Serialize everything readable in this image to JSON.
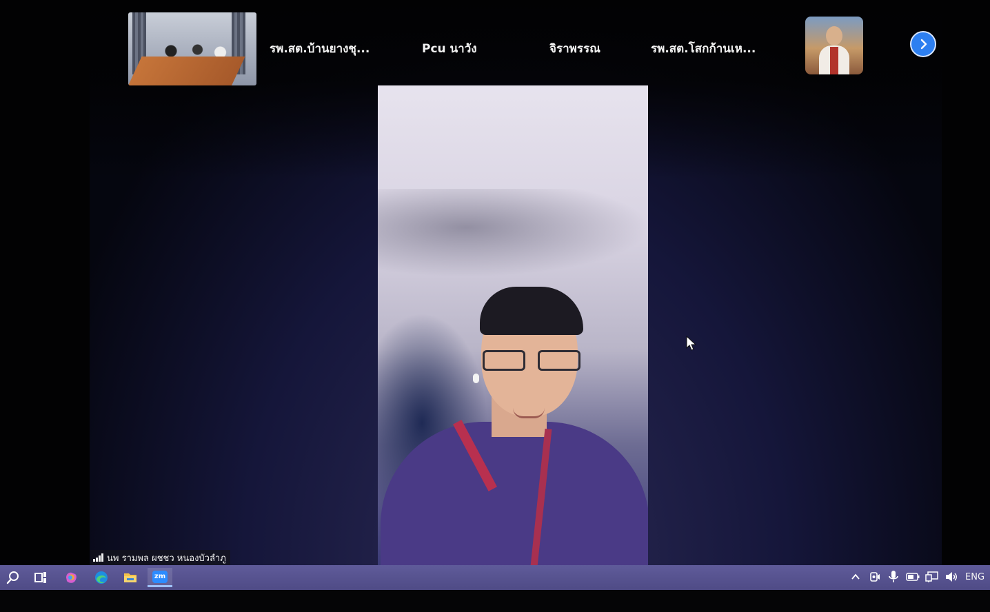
{
  "gallery": {
    "names": [
      "รพ.สต.บ้านยางชุ...",
      "Pcu นาวัง",
      "จิราพรรณ",
      "รพ.สต.โสกก้านเห..."
    ],
    "next_icon": "chevron-right-icon"
  },
  "active_speaker": {
    "name": "นพ รามพล ผชชว หนองบัวลำภู"
  },
  "taskbar": {
    "apps": [
      "search-icon",
      "task-view-icon",
      "copilot-icon",
      "edge-icon",
      "file-explorer-icon",
      "zoom-icon"
    ],
    "zoom_label": "zm",
    "tray": {
      "language": "ENG"
    }
  },
  "colors": {
    "accent": "#2d7ff0",
    "taskbar": "#5f5b9a"
  }
}
